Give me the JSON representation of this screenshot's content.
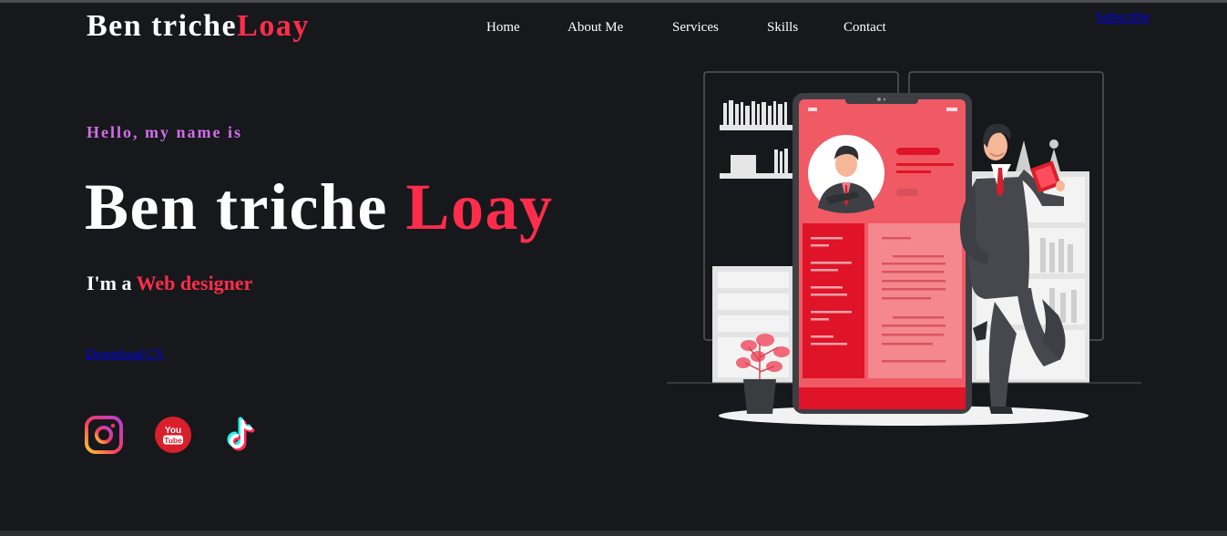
{
  "header": {
    "logo_main": "Ben triche",
    "logo_accent": "Loay",
    "nav": [
      "Home",
      "About Me",
      "Services",
      "Skills",
      "Contact"
    ],
    "subscribe_label": "Subscribe"
  },
  "hero": {
    "greeting": "Hello, my name is",
    "name_main": "Ben triche ",
    "name_accent": "Loay",
    "role_prefix": "I'm a ",
    "role_accent": "Web designer",
    "download_label": "Download CV"
  },
  "social": [
    {
      "icon": "instagram-icon"
    },
    {
      "icon": "youtube-icon",
      "label_top": "You",
      "label_bottom": "Tube"
    },
    {
      "icon": "tiktok-icon"
    }
  ],
  "colors": {
    "background": "#16181c",
    "accent": "#ff2d4b",
    "greeting": "#d26ee8",
    "text": "#ffffff",
    "link": "#0000ee"
  }
}
